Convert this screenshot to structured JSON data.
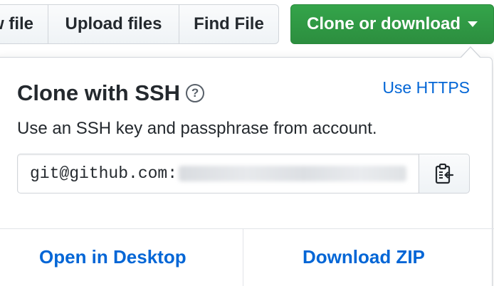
{
  "toolbar": {
    "new_file_label": "w file",
    "upload_label": "Upload files",
    "find_label": "Find File",
    "clone_label": "Clone or download"
  },
  "clone_panel": {
    "title": "Clone with SSH",
    "help_symbol": "?",
    "switch_protocol_label": "Use HTTPS",
    "description": "Use an SSH key and passphrase from account.",
    "url_prefix": "git@github.com:",
    "copy_icon": "clipboard-icon"
  },
  "footer": {
    "open_desktop_label": "Open in Desktop",
    "download_zip_label": "Download ZIP"
  },
  "colors": {
    "accent_green": "#2c974b",
    "link_blue": "#0366d6",
    "text": "#24292e",
    "border": "#d1d5da"
  }
}
